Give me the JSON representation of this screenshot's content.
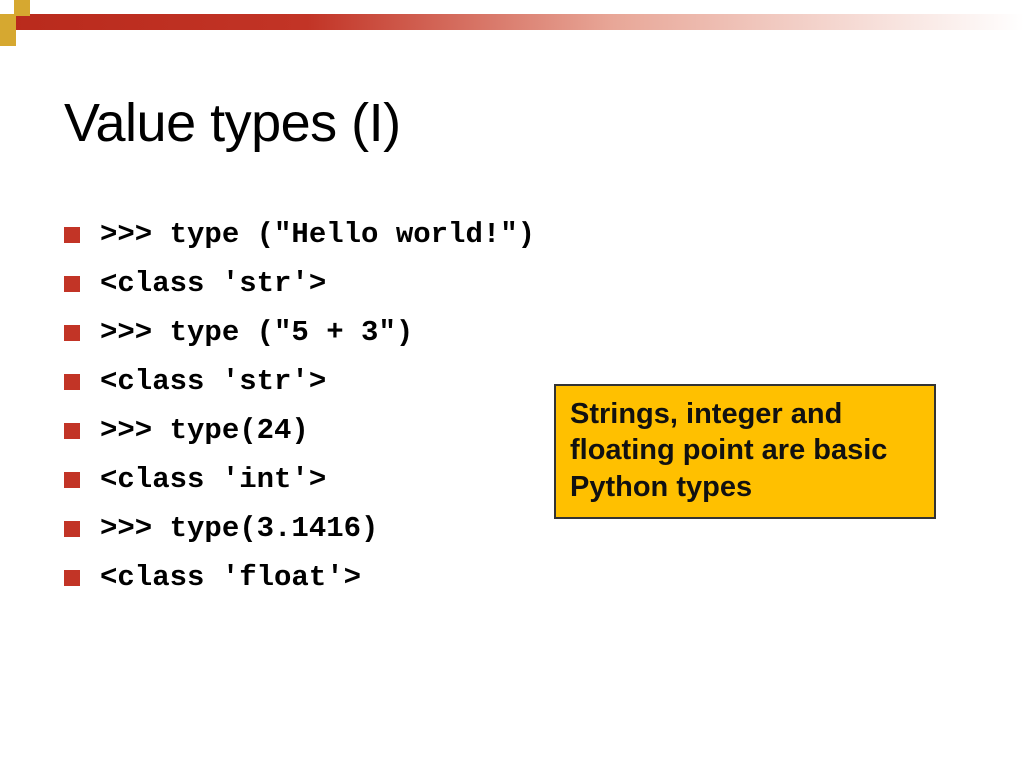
{
  "title": "Value types (I)",
  "items": [
    ">>> type (\"Hello world!\")",
    "<class 'str'>",
    ">>> type (\"5 + 3\")",
    "<class 'str'>",
    ">>> type(24)",
    "<class 'int'>",
    ">>> type(3.1416)",
    "<class 'float'>"
  ],
  "callout": "Strings, integer and floating point are basic Python types"
}
